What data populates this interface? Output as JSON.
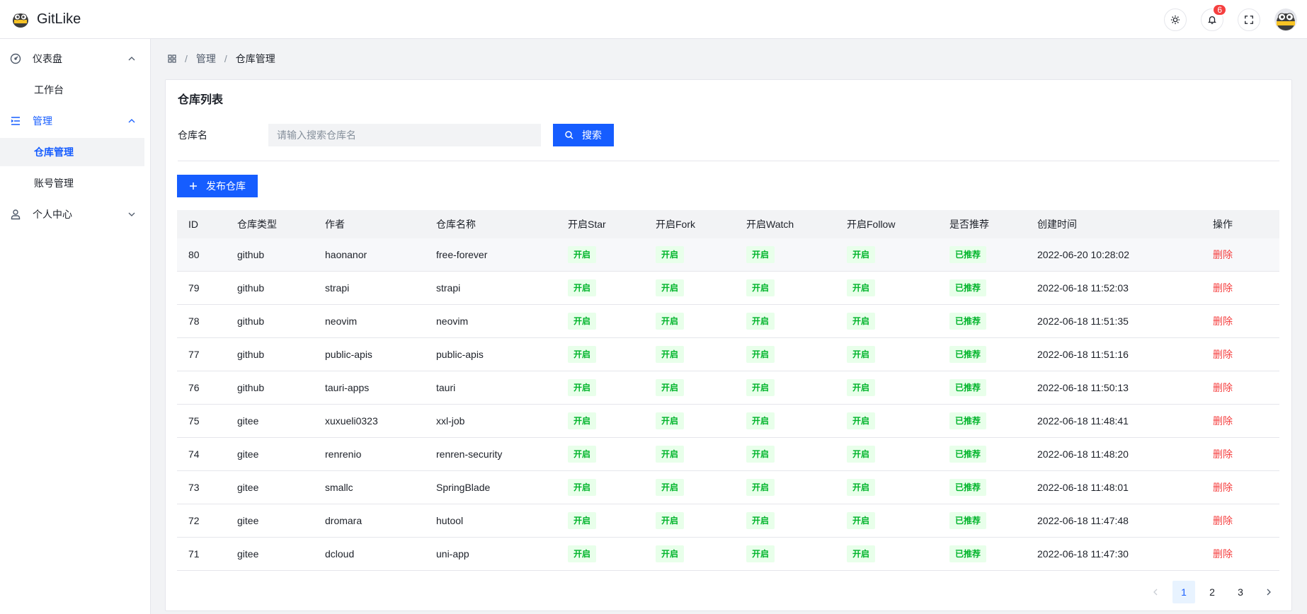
{
  "app": {
    "name": "GitLike"
  },
  "header": {
    "notification_count": "6"
  },
  "sidebar": {
    "groups": [
      {
        "label": "仪表盘",
        "children": [
          "工作台"
        ]
      },
      {
        "label": "管理",
        "children": [
          "仓库管理",
          "账号管理"
        ]
      },
      {
        "label": "个人中心",
        "children": []
      }
    ]
  },
  "breadcrumb": {
    "items": [
      "管理",
      "仓库管理"
    ]
  },
  "card": {
    "title": "仓库列表",
    "search_label": "仓库名",
    "search_placeholder": "请输入搜索仓库名",
    "search_button": "搜索",
    "add_button": "发布仓库"
  },
  "table": {
    "columns": [
      "ID",
      "仓库类型",
      "作者",
      "仓库名称",
      "开启Star",
      "开启Fork",
      "开启Watch",
      "开启Follow",
      "是否推荐",
      "创建时间",
      "操作"
    ],
    "rows": [
      {
        "id": "80",
        "type": "github",
        "author": "haonanor",
        "name": "free-forever",
        "star": "开启",
        "fork": "开启",
        "watch": "开启",
        "follow": "开启",
        "rec": "已推荐",
        "time": "2022-06-20 10:28:02",
        "op": "删除"
      },
      {
        "id": "79",
        "type": "github",
        "author": "strapi",
        "name": "strapi",
        "star": "开启",
        "fork": "开启",
        "watch": "开启",
        "follow": "开启",
        "rec": "已推荐",
        "time": "2022-06-18 11:52:03",
        "op": "删除"
      },
      {
        "id": "78",
        "type": "github",
        "author": "neovim",
        "name": "neovim",
        "star": "开启",
        "fork": "开启",
        "watch": "开启",
        "follow": "开启",
        "rec": "已推荐",
        "time": "2022-06-18 11:51:35",
        "op": "删除"
      },
      {
        "id": "77",
        "type": "github",
        "author": "public-apis",
        "name": "public-apis",
        "star": "开启",
        "fork": "开启",
        "watch": "开启",
        "follow": "开启",
        "rec": "已推荐",
        "time": "2022-06-18 11:51:16",
        "op": "删除"
      },
      {
        "id": "76",
        "type": "github",
        "author": "tauri-apps",
        "name": "tauri",
        "star": "开启",
        "fork": "开启",
        "watch": "开启",
        "follow": "开启",
        "rec": "已推荐",
        "time": "2022-06-18 11:50:13",
        "op": "删除"
      },
      {
        "id": "75",
        "type": "gitee",
        "author": "xuxueli0323",
        "name": "xxl-job",
        "star": "开启",
        "fork": "开启",
        "watch": "开启",
        "follow": "开启",
        "rec": "已推荐",
        "time": "2022-06-18 11:48:41",
        "op": "删除"
      },
      {
        "id": "74",
        "type": "gitee",
        "author": "renrenio",
        "name": "renren-security",
        "star": "开启",
        "fork": "开启",
        "watch": "开启",
        "follow": "开启",
        "rec": "已推荐",
        "time": "2022-06-18 11:48:20",
        "op": "删除"
      },
      {
        "id": "73",
        "type": "gitee",
        "author": "smallc",
        "name": "SpringBlade",
        "star": "开启",
        "fork": "开启",
        "watch": "开启",
        "follow": "开启",
        "rec": "已推荐",
        "time": "2022-06-18 11:48:01",
        "op": "删除"
      },
      {
        "id": "72",
        "type": "gitee",
        "author": "dromara",
        "name": "hutool",
        "star": "开启",
        "fork": "开启",
        "watch": "开启",
        "follow": "开启",
        "rec": "已推荐",
        "time": "2022-06-18 11:47:48",
        "op": "删除"
      },
      {
        "id": "71",
        "type": "gitee",
        "author": "dcloud",
        "name": "uni-app",
        "star": "开启",
        "fork": "开启",
        "watch": "开启",
        "follow": "开启",
        "rec": "已推荐",
        "time": "2022-06-18 11:47:30",
        "op": "删除"
      }
    ]
  },
  "pagination": {
    "pages": [
      "1",
      "2",
      "3"
    ],
    "current": "1"
  },
  "colors": {
    "primary": "#165dff",
    "success": "#00b42a",
    "success_bg": "#e8ffea",
    "danger": "#f53f3f"
  }
}
